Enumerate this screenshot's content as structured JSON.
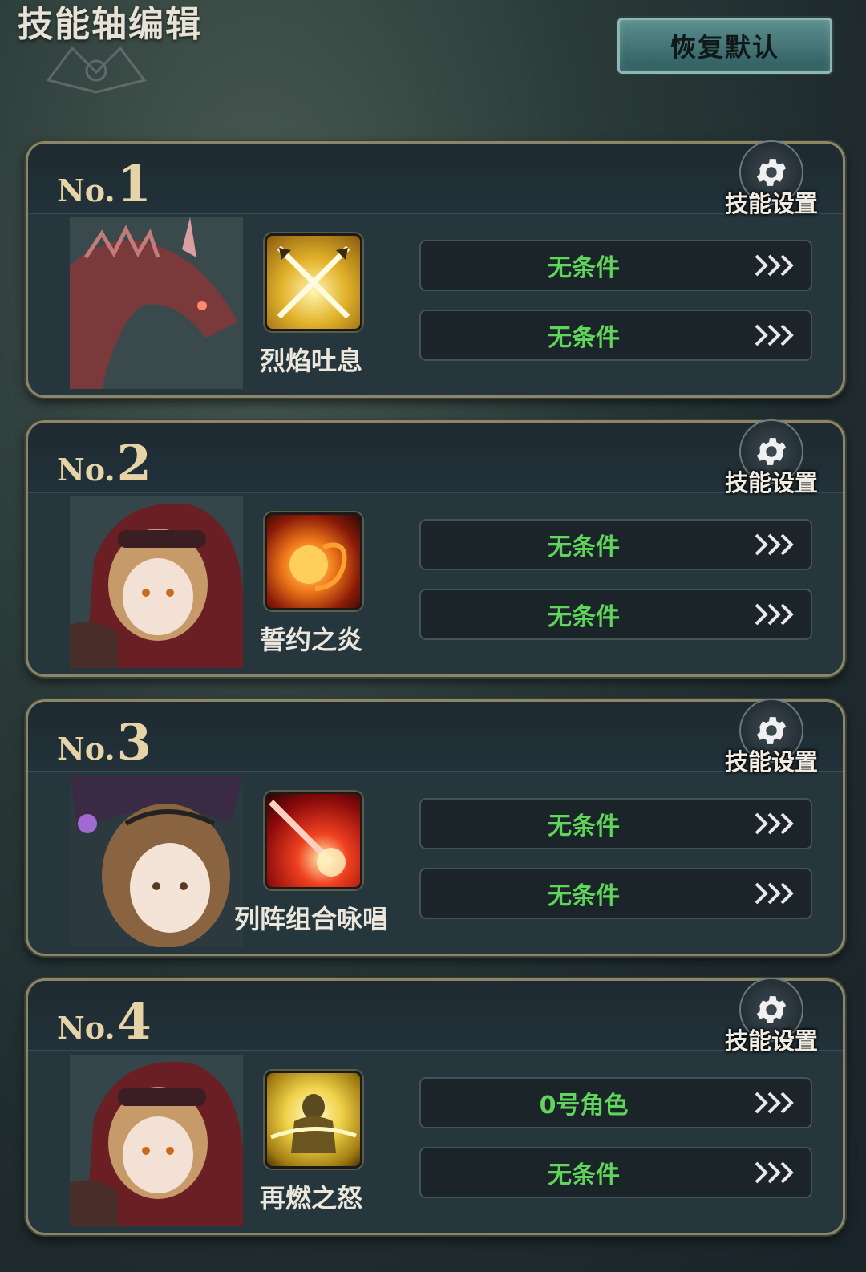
{
  "header": {
    "title": "技能轴编辑",
    "reset_label": "恢复默认"
  },
  "colors": {
    "condition_text": "#5fd65a",
    "card_bg": "#26363d",
    "card_border": "#8c8668",
    "number_gold": "#e6d3a8"
  },
  "cards": [
    {
      "no_prefix": "No.",
      "no_num": "1",
      "settings_label": "技能设置",
      "portrait": "red-dragon",
      "skill_icon": "crossed-swords-gold",
      "skill_name": "烈焰吐息",
      "conditions": [
        "无条件",
        "无条件"
      ]
    },
    {
      "no_prefix": "No.",
      "no_num": "2",
      "settings_label": "技能设置",
      "portrait": "girl-red-hood",
      "skill_icon": "fireball",
      "skill_name": "誓约之炎",
      "conditions": [
        "无条件",
        "无条件"
      ]
    },
    {
      "no_prefix": "No.",
      "no_num": "3",
      "settings_label": "技能设置",
      "portrait": "girl-witch-hat",
      "skill_icon": "red-beam-burst",
      "skill_name": "列阵组合咏唱",
      "conditions": [
        "无条件",
        "无条件"
      ]
    },
    {
      "no_prefix": "No.",
      "no_num": "4",
      "settings_label": "技能设置",
      "portrait": "girl-red-hood",
      "skill_icon": "golden-knight-aura",
      "skill_name": "再燃之怒",
      "conditions": [
        "0号角色",
        "无条件"
      ]
    }
  ]
}
